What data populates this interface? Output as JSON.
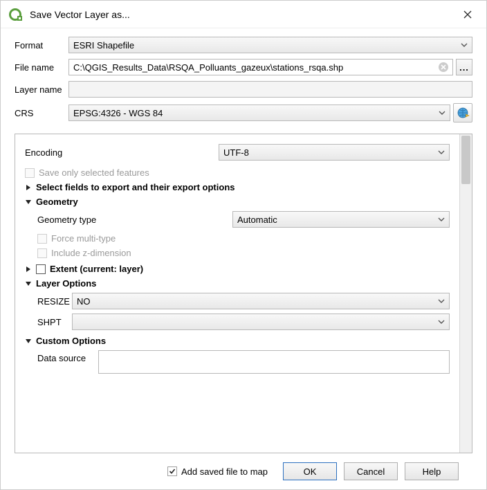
{
  "window": {
    "title": "Save Vector Layer as..."
  },
  "top": {
    "format_label": "Format",
    "format_value": "ESRI Shapefile",
    "filename_label": "File name",
    "filename_value": "C:\\QGIS_Results_Data\\RSQA_Polluants_gazeux\\stations_rsqa.shp",
    "browse_label": "...",
    "layername_label": "Layer name",
    "layername_value": "",
    "crs_label": "CRS",
    "crs_value": "EPSG:4326 - WGS 84"
  },
  "body": {
    "encoding_label": "Encoding",
    "encoding_value": "UTF-8",
    "save_selected_label": "Save only selected features",
    "select_fields_label": "Select fields to export and their export options",
    "geometry_label": "Geometry",
    "geometry_type_label": "Geometry type",
    "geometry_type_value": "Automatic",
    "force_multi_label": "Force multi-type",
    "include_z_label": "Include z-dimension",
    "extent_label": "Extent (current: layer)",
    "layer_options_label": "Layer Options",
    "resize_label": "RESIZE",
    "resize_value": "NO",
    "shpt_label": "SHPT",
    "shpt_value": "",
    "custom_options_label": "Custom Options",
    "data_source_label": "Data source"
  },
  "footer": {
    "add_saved_label": "Add saved file to map",
    "ok": "OK",
    "cancel": "Cancel",
    "help": "Help"
  }
}
